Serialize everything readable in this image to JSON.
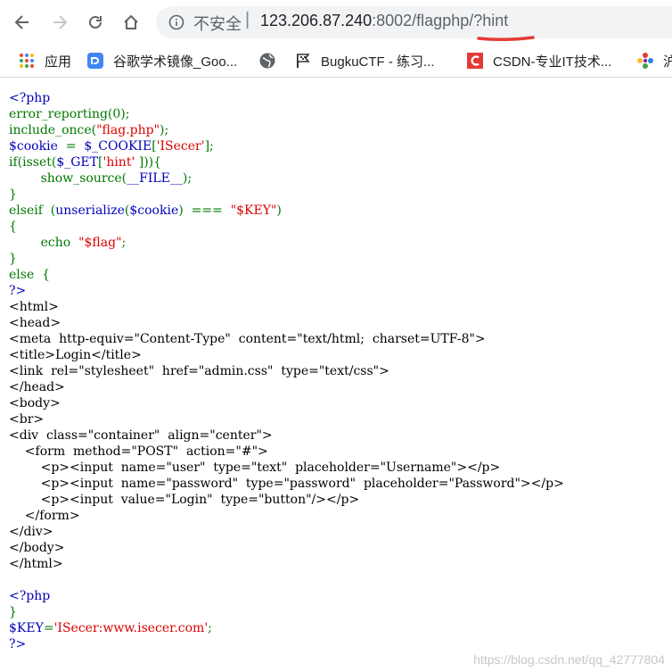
{
  "browser": {
    "security_label": "不安全",
    "separator": "|",
    "url_host": "123.206.87.240",
    "url_rest": ":8002/flagphp/?hint"
  },
  "bookmarks": [
    {
      "icon": "apps-grid-icon",
      "label": "应用"
    },
    {
      "icon": "google-scholar-icon",
      "label": "谷歌学术镜像_Goo..."
    },
    {
      "icon": "globe-icon",
      "label": ""
    },
    {
      "icon": "bugku-flag-icon",
      "label": "BugkuCTF - 练习..."
    },
    {
      "icon": "csdn-icon",
      "label": "CSDN-专业IT技术..."
    },
    {
      "icon": "flower-icon",
      "label": "沪"
    }
  ],
  "source_lines": [
    [
      [
        "<?php",
        "#0000BB"
      ]
    ],
    [
      [
        "error_reporting(0);",
        "#007700"
      ]
    ],
    [
      [
        "include_once(",
        "#007700"
      ],
      [
        "\"flag.php\"",
        "#DD0000"
      ],
      [
        ");",
        "#007700"
      ]
    ],
    [
      [
        "$cookie",
        "#0000BB"
      ],
      [
        "  =  ",
        "#007700"
      ],
      [
        "$_COOKIE",
        "#0000BB"
      ],
      [
        "[",
        "#007700"
      ],
      [
        "'ISecer'",
        "#DD0000"
      ],
      [
        "];",
        "#007700"
      ]
    ],
    [
      [
        "if(isset(",
        "#007700"
      ],
      [
        "$_GET",
        "#0000BB"
      ],
      [
        "[",
        "#007700"
      ],
      [
        "'hint'",
        "#DD0000"
      ],
      [
        " ])){",
        "#007700"
      ]
    ],
    [
      [
        "        show_source(",
        "#007700"
      ],
      [
        "__FILE__",
        "#0000BB"
      ],
      [
        ");",
        "#007700"
      ]
    ],
    [
      [
        "}",
        "#007700"
      ]
    ],
    [
      [
        "elseif  (",
        "#007700"
      ],
      [
        "unserialize",
        "#0000BB"
      ],
      [
        "(",
        "#007700"
      ],
      [
        "$cookie",
        "#0000BB"
      ],
      [
        ")  ===  ",
        "#007700"
      ],
      [
        "\"$KEY\"",
        "#DD0000"
      ],
      [
        ")",
        "#007700"
      ]
    ],
    [
      [
        "{",
        "#007700"
      ]
    ],
    [
      [
        "        echo  ",
        "#007700"
      ],
      [
        "\"$flag\"",
        "#DD0000"
      ],
      [
        ";",
        "#007700"
      ]
    ],
    [
      [
        "}",
        "#007700"
      ]
    ],
    [
      [
        "else  {",
        "#007700"
      ]
    ],
    [
      [
        "?>",
        "#0000BB"
      ]
    ],
    [
      [
        "<html>",
        "#000000"
      ]
    ],
    [
      [
        "<head>",
        "#000000"
      ]
    ],
    [
      [
        "<meta  http-equiv=\"Content-Type\"  content=\"text/html;  charset=UTF-8\">",
        "#000000"
      ]
    ],
    [
      [
        "<title>Login</title>",
        "#000000"
      ]
    ],
    [
      [
        "<link  rel=\"stylesheet\"  href=\"admin.css\"  type=\"text/css\">",
        "#000000"
      ]
    ],
    [
      [
        "</head>",
        "#000000"
      ]
    ],
    [
      [
        "<body>",
        "#000000"
      ]
    ],
    [
      [
        "<br>",
        "#000000"
      ]
    ],
    [
      [
        "<div  class=\"container\"  align=\"center\">",
        "#000000"
      ]
    ],
    [
      [
        "    <form  method=\"POST\"  action=\"#\">",
        "#000000"
      ]
    ],
    [
      [
        "        <p><input  name=\"user\"  type=\"text\"  placeholder=\"Username\"></p>",
        "#000000"
      ]
    ],
    [
      [
        "        <p><input  name=\"password\"  type=\"password\"  placeholder=\"Password\"></p>",
        "#000000"
      ]
    ],
    [
      [
        "        <p><input  value=\"Login\"  type=\"button\"/></p>",
        "#000000"
      ]
    ],
    [
      [
        "    </form>",
        "#000000"
      ]
    ],
    [
      [
        "</div>",
        "#000000"
      ]
    ],
    [
      [
        "</body>",
        "#000000"
      ]
    ],
    [
      [
        "</html>",
        "#000000"
      ]
    ],
    [
      [
        "",
        "#000000"
      ]
    ],
    [
      [
        "<?php",
        "#0000BB"
      ]
    ],
    [
      [
        "}",
        "#007700"
      ]
    ],
    [
      [
        "$KEY",
        "#0000BB"
      ],
      [
        "=",
        "#007700"
      ],
      [
        "'ISecer:www.isecer.com'",
        "#DD0000"
      ],
      [
        ";",
        "#007700"
      ]
    ],
    [
      [
        "?>",
        "#0000BB"
      ]
    ]
  ],
  "watermark": "https://blog.csdn.net/qq_42777804"
}
